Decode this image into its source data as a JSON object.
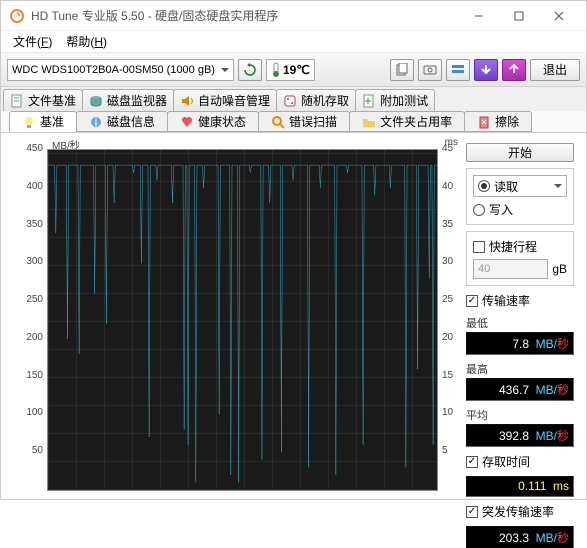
{
  "window": {
    "title": "HD Tune 专业版 5.50 - 硬盘/固态硬盘实用程序"
  },
  "menu": {
    "file": "文件(",
    "file_u": "F",
    "file_e": ")",
    "help": "帮助(",
    "help_u": "H",
    "help_e": ")"
  },
  "toolbar": {
    "drive": "WDC WDS100T2B0A-00SM50 (1000 gB)",
    "temp": "19℃",
    "exit": "退出"
  },
  "tabs_top": [
    {
      "icon": "doc-icon",
      "label": "文件基准"
    },
    {
      "icon": "disk-icon",
      "label": "磁盘监视器"
    },
    {
      "icon": "speaker-icon",
      "label": "自动噪音管理"
    },
    {
      "icon": "dice-icon",
      "label": "随机存取"
    },
    {
      "icon": "plus-icon",
      "label": "附加测试"
    }
  ],
  "tabs_sub": [
    {
      "icon": "bulb-icon",
      "label": "基准",
      "active": true
    },
    {
      "icon": "info-icon",
      "label": "磁盘信息"
    },
    {
      "icon": "health-icon",
      "label": "健康状态"
    },
    {
      "icon": "scan-icon",
      "label": "错误扫描"
    },
    {
      "icon": "folder-icon",
      "label": "文件夹占用率"
    },
    {
      "icon": "erase-icon",
      "label": "擦除"
    }
  ],
  "chart_data": {
    "type": "line",
    "ylabel": "MB/秒",
    "rlabel": "ms",
    "y_ticks": [
      450,
      400,
      350,
      300,
      250,
      200,
      150,
      100,
      50
    ],
    "r_ticks": [
      45,
      40,
      35,
      30,
      25,
      20,
      15,
      10,
      5
    ],
    "ylim": [
      0,
      450
    ],
    "baseline_y": 430,
    "dips": [
      {
        "x": 2,
        "y": 340
      },
      {
        "x": 5,
        "y": 200
      },
      {
        "x": 8,
        "y": 180
      },
      {
        "x": 12,
        "y": 260
      },
      {
        "x": 15,
        "y": 220
      },
      {
        "x": 17,
        "y": 380
      },
      {
        "x": 22,
        "y": 420
      },
      {
        "x": 24,
        "y": 300
      },
      {
        "x": 26,
        "y": 70
      },
      {
        "x": 28,
        "y": 410
      },
      {
        "x": 32,
        "y": 380
      },
      {
        "x": 35,
        "y": 80
      },
      {
        "x": 36,
        "y": 60
      },
      {
        "x": 38,
        "y": 10
      },
      {
        "x": 40,
        "y": 400
      },
      {
        "x": 44,
        "y": 100
      },
      {
        "x": 47,
        "y": 20
      },
      {
        "x": 49,
        "y": 10
      },
      {
        "x": 52,
        "y": 420
      },
      {
        "x": 55,
        "y": 40
      },
      {
        "x": 57,
        "y": 380
      },
      {
        "x": 60,
        "y": 50
      },
      {
        "x": 63,
        "y": 410
      },
      {
        "x": 67,
        "y": 30
      },
      {
        "x": 70,
        "y": 400
      },
      {
        "x": 74,
        "y": 20
      },
      {
        "x": 77,
        "y": 420
      },
      {
        "x": 81,
        "y": 60
      },
      {
        "x": 84,
        "y": 390
      },
      {
        "x": 88,
        "y": 400
      },
      {
        "x": 92,
        "y": 30
      },
      {
        "x": 95,
        "y": 160
      },
      {
        "x": 98,
        "y": 280
      },
      {
        "x": 99,
        "y": 60
      }
    ]
  },
  "side": {
    "start": "开始",
    "read": "读取",
    "write": "写入",
    "quick": "快捷行程",
    "quick_val": "40",
    "quick_unit": "gB",
    "rate": "传输速率",
    "min_l": "最低",
    "min_v": "7.8",
    "mb": "MB/",
    "sec": "秒",
    "max_l": "最高",
    "max_v": "436.7",
    "avg_l": "平均",
    "avg_v": "392.8",
    "access_l": "存取时间",
    "access_v": "0.111",
    "ms": "ms",
    "burst_l": "突发传输速率",
    "burst_v": "203.3"
  }
}
